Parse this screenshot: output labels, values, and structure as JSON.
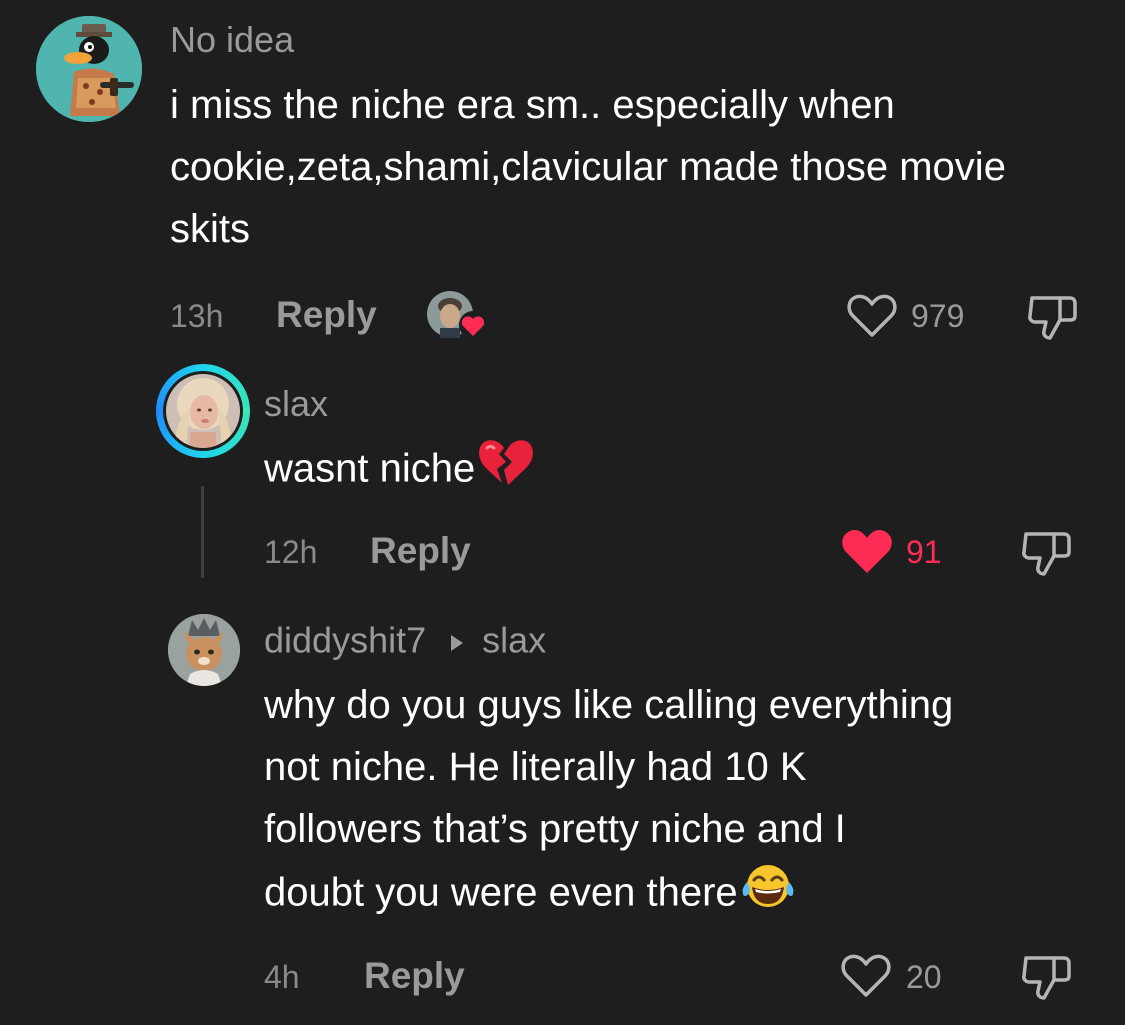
{
  "comments": [
    {
      "avatar": "duck-avatar",
      "username": "No idea",
      "text": "i miss the niche era sm.. especially when cookie,zeta,shami,clavicular made those movie skits",
      "time": "13h",
      "reply_label": "Reply",
      "likes": "979",
      "liked": false,
      "creator_liked_icon": "creator-heart-badge"
    },
    {
      "avatar": "woman-avatar",
      "username": "slax",
      "text": "wasnt niche",
      "emoji": "broken-heart-emoji",
      "time": "12h",
      "reply_label": "Reply",
      "likes": "91",
      "liked": true,
      "accent_color": "#fe2c55"
    },
    {
      "avatar": "cat-avatar",
      "username": "diddyshit7",
      "reply_to": "slax",
      "text_lines": [
        "why do you guys like calling everything",
        "not niche. He literally had 10 K",
        "followers that’s pretty niche and I",
        "doubt you were even there"
      ],
      "emoji": "laughing-tears-emoji",
      "time": "4h",
      "reply_label": "Reply",
      "likes": "20",
      "liked": false
    }
  ]
}
